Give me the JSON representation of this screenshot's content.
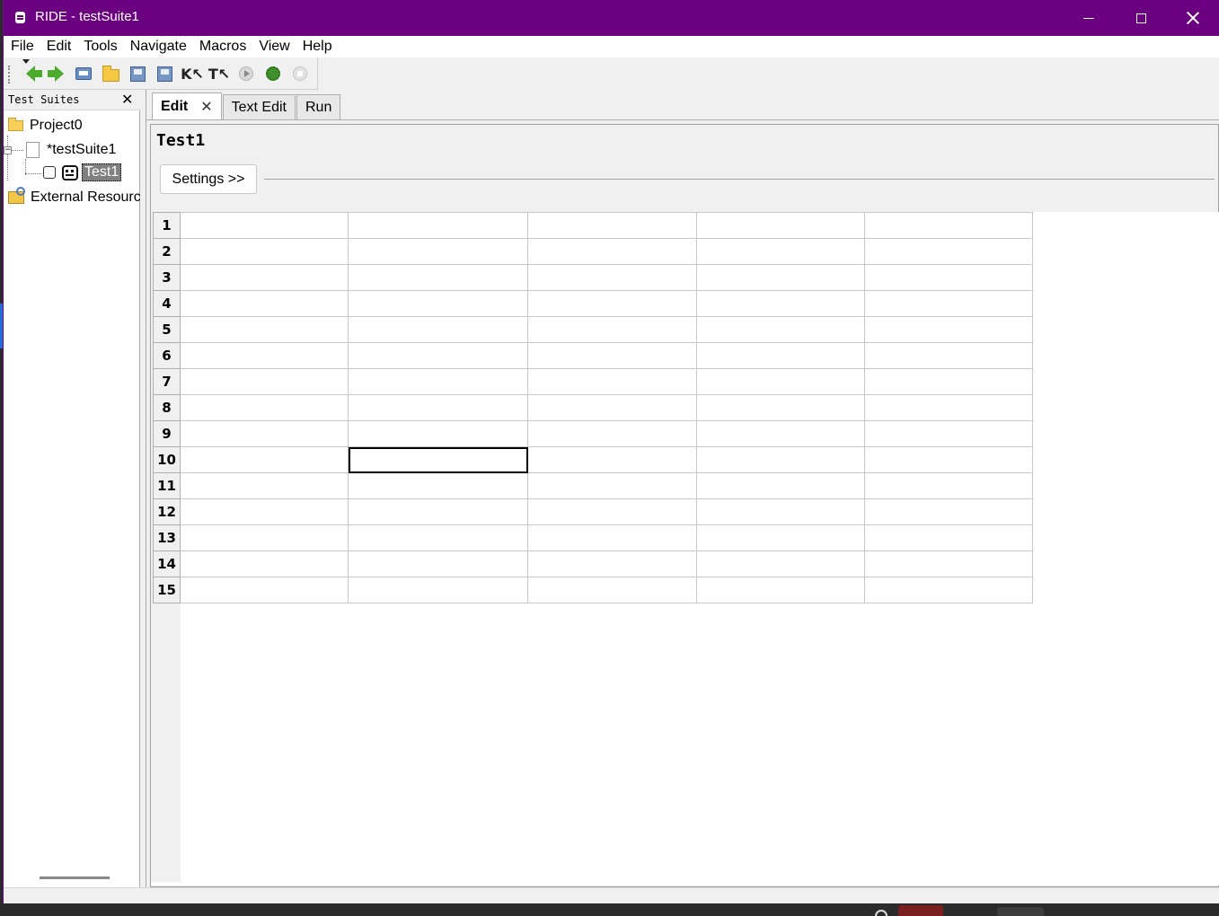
{
  "window": {
    "title": "RIDE - testSuite1",
    "accent_color": "#6b0080"
  },
  "menu": [
    "File",
    "Edit",
    "Tools",
    "Navigate",
    "Macros",
    "View",
    "Help"
  ],
  "toolbar": {
    "icons": [
      "back-icon",
      "forward-icon",
      "open-icon",
      "open-directory-icon",
      "save-icon",
      "save-all-icon",
      "search-keywords-icon",
      "search-tests-icon",
      "run-icon",
      "debug-icon",
      "stop-icon"
    ]
  },
  "left_panel": {
    "title": "Test Suites",
    "tree": {
      "project": "Project0",
      "suite": "*testSuite1",
      "test": "Test1",
      "external": "External Resourc"
    }
  },
  "tabs": [
    {
      "label": "Edit",
      "active": true
    },
    {
      "label": "Text Edit",
      "active": false
    },
    {
      "label": "Run",
      "active": false
    }
  ],
  "editor": {
    "test_name": "Test1",
    "settings_button": "Settings >>",
    "rows": [
      "1",
      "2",
      "3",
      "4",
      "5",
      "6",
      "7",
      "8",
      "9",
      "10",
      "11",
      "12",
      "13",
      "14",
      "15"
    ],
    "selected_cell": {
      "row": 10,
      "column": 2
    }
  }
}
